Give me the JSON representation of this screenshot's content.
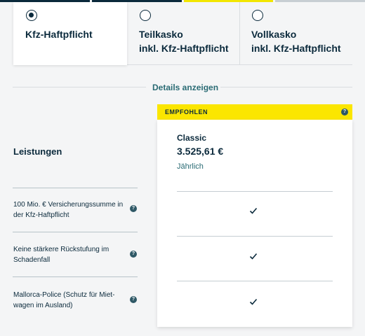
{
  "tabs": [
    {
      "label_line1": "Kfz-Haftpflicht",
      "label_line2": "",
      "selected": true
    },
    {
      "label_line1": "Teilkasko",
      "label_line2": "inkl. Kfz-Haftpflicht",
      "selected": false
    },
    {
      "label_line1": "Vollkasko",
      "label_line2": "inkl. Kfz-Haftpflicht",
      "selected": false
    }
  ],
  "details_link": "Details anzeigen",
  "left": {
    "heading": "Leistungen",
    "features": [
      {
        "text": "100 Mio. € Versicherungssumme in der Kfz-Haftpflicht",
        "help_icon": "?"
      },
      {
        "text": "Keine stärkere Rückstufung im Schadenfall",
        "help_icon": "?"
      },
      {
        "text": "Mallorca-Police (Schutz für Miet-wagen im Ausland)",
        "help_icon": "?"
      }
    ]
  },
  "card": {
    "badge": "EMPFOHLEN",
    "badge_help": "?",
    "plan": "Classic",
    "price": "3.525,61 €",
    "period": "Jährlich",
    "included": [
      true,
      true,
      true
    ]
  },
  "colors": {
    "accent": "#fbe600",
    "primary": "#0b2a3c",
    "link": "#2a6b74"
  }
}
